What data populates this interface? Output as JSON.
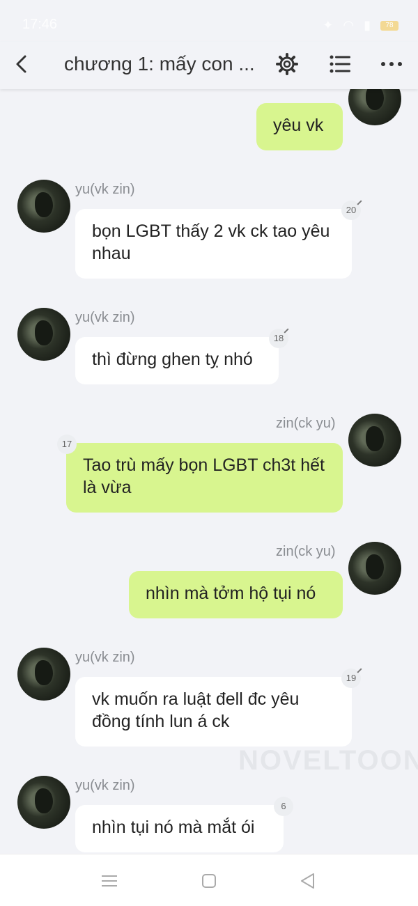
{
  "status_bar": {
    "time": "17:46",
    "battery": "78"
  },
  "header": {
    "title": "chương 1: mấy con ...",
    "icons": [
      "back-icon",
      "gear-icon",
      "list-icon",
      "more-icon"
    ]
  },
  "messages": [
    {
      "side": "right",
      "sender": "",
      "text": "yêu vk",
      "badge": ""
    },
    {
      "side": "left",
      "sender": "yu(vk zin)",
      "text": "bọn LGBT thấy 2 vk ck tao yêu nhau",
      "badge": "20"
    },
    {
      "side": "left",
      "sender": "yu(vk zin)",
      "text": "thì đừng ghen tỵ nhó",
      "badge": "18"
    },
    {
      "side": "right",
      "sender": "zin(ck yu)",
      "text": "Tao trù mấy bọn LGBT ch3t hết là vừa",
      "badge": "17"
    },
    {
      "side": "right",
      "sender": "zin(ck yu)",
      "text": "nhìn mà tởm hộ tụi nó",
      "badge": ""
    },
    {
      "side": "left",
      "sender": "yu(vk zin)",
      "text": "vk muốn ra luật đell đc yêu đồng tính lun á ck",
      "badge": "19"
    },
    {
      "side": "left",
      "sender": "yu(vk zin)",
      "text": "nhìn tụi nó mà mắt ói",
      "badge": "6"
    }
  ],
  "watermark": "NOVELTOON",
  "colors": {
    "background": "#f2f3f7",
    "right_bubble": "#d8f58f",
    "left_bubble": "#ffffff",
    "name_text": "#8a8d92"
  },
  "nav": {
    "icons": [
      "menu-icon",
      "home-square-icon",
      "back-triangle-icon"
    ]
  }
}
